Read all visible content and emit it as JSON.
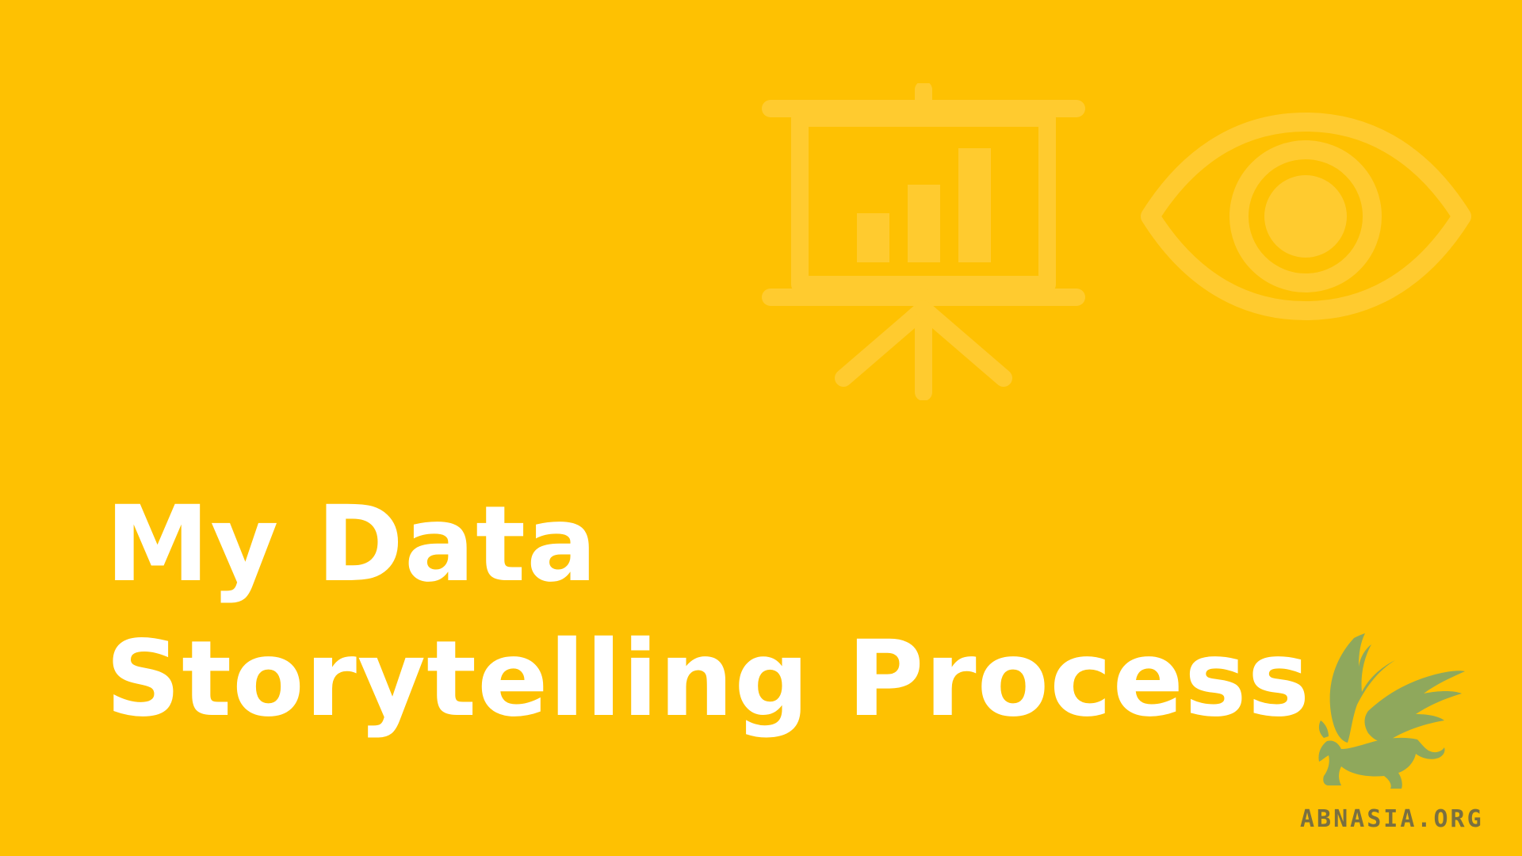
{
  "colors": {
    "background": "#FEC102",
    "icon": "#FFCB2F",
    "title": "#FFFFFF",
    "logo": "#8FA85C",
    "watermark": "#7A7040"
  },
  "icons": {
    "left": "presentation-board-bar-chart-icon",
    "right": "eye-icon"
  },
  "title": {
    "line1": "My Data",
    "line2": "Storytelling Process"
  },
  "watermark": {
    "text": "ABNASIA.ORG"
  }
}
